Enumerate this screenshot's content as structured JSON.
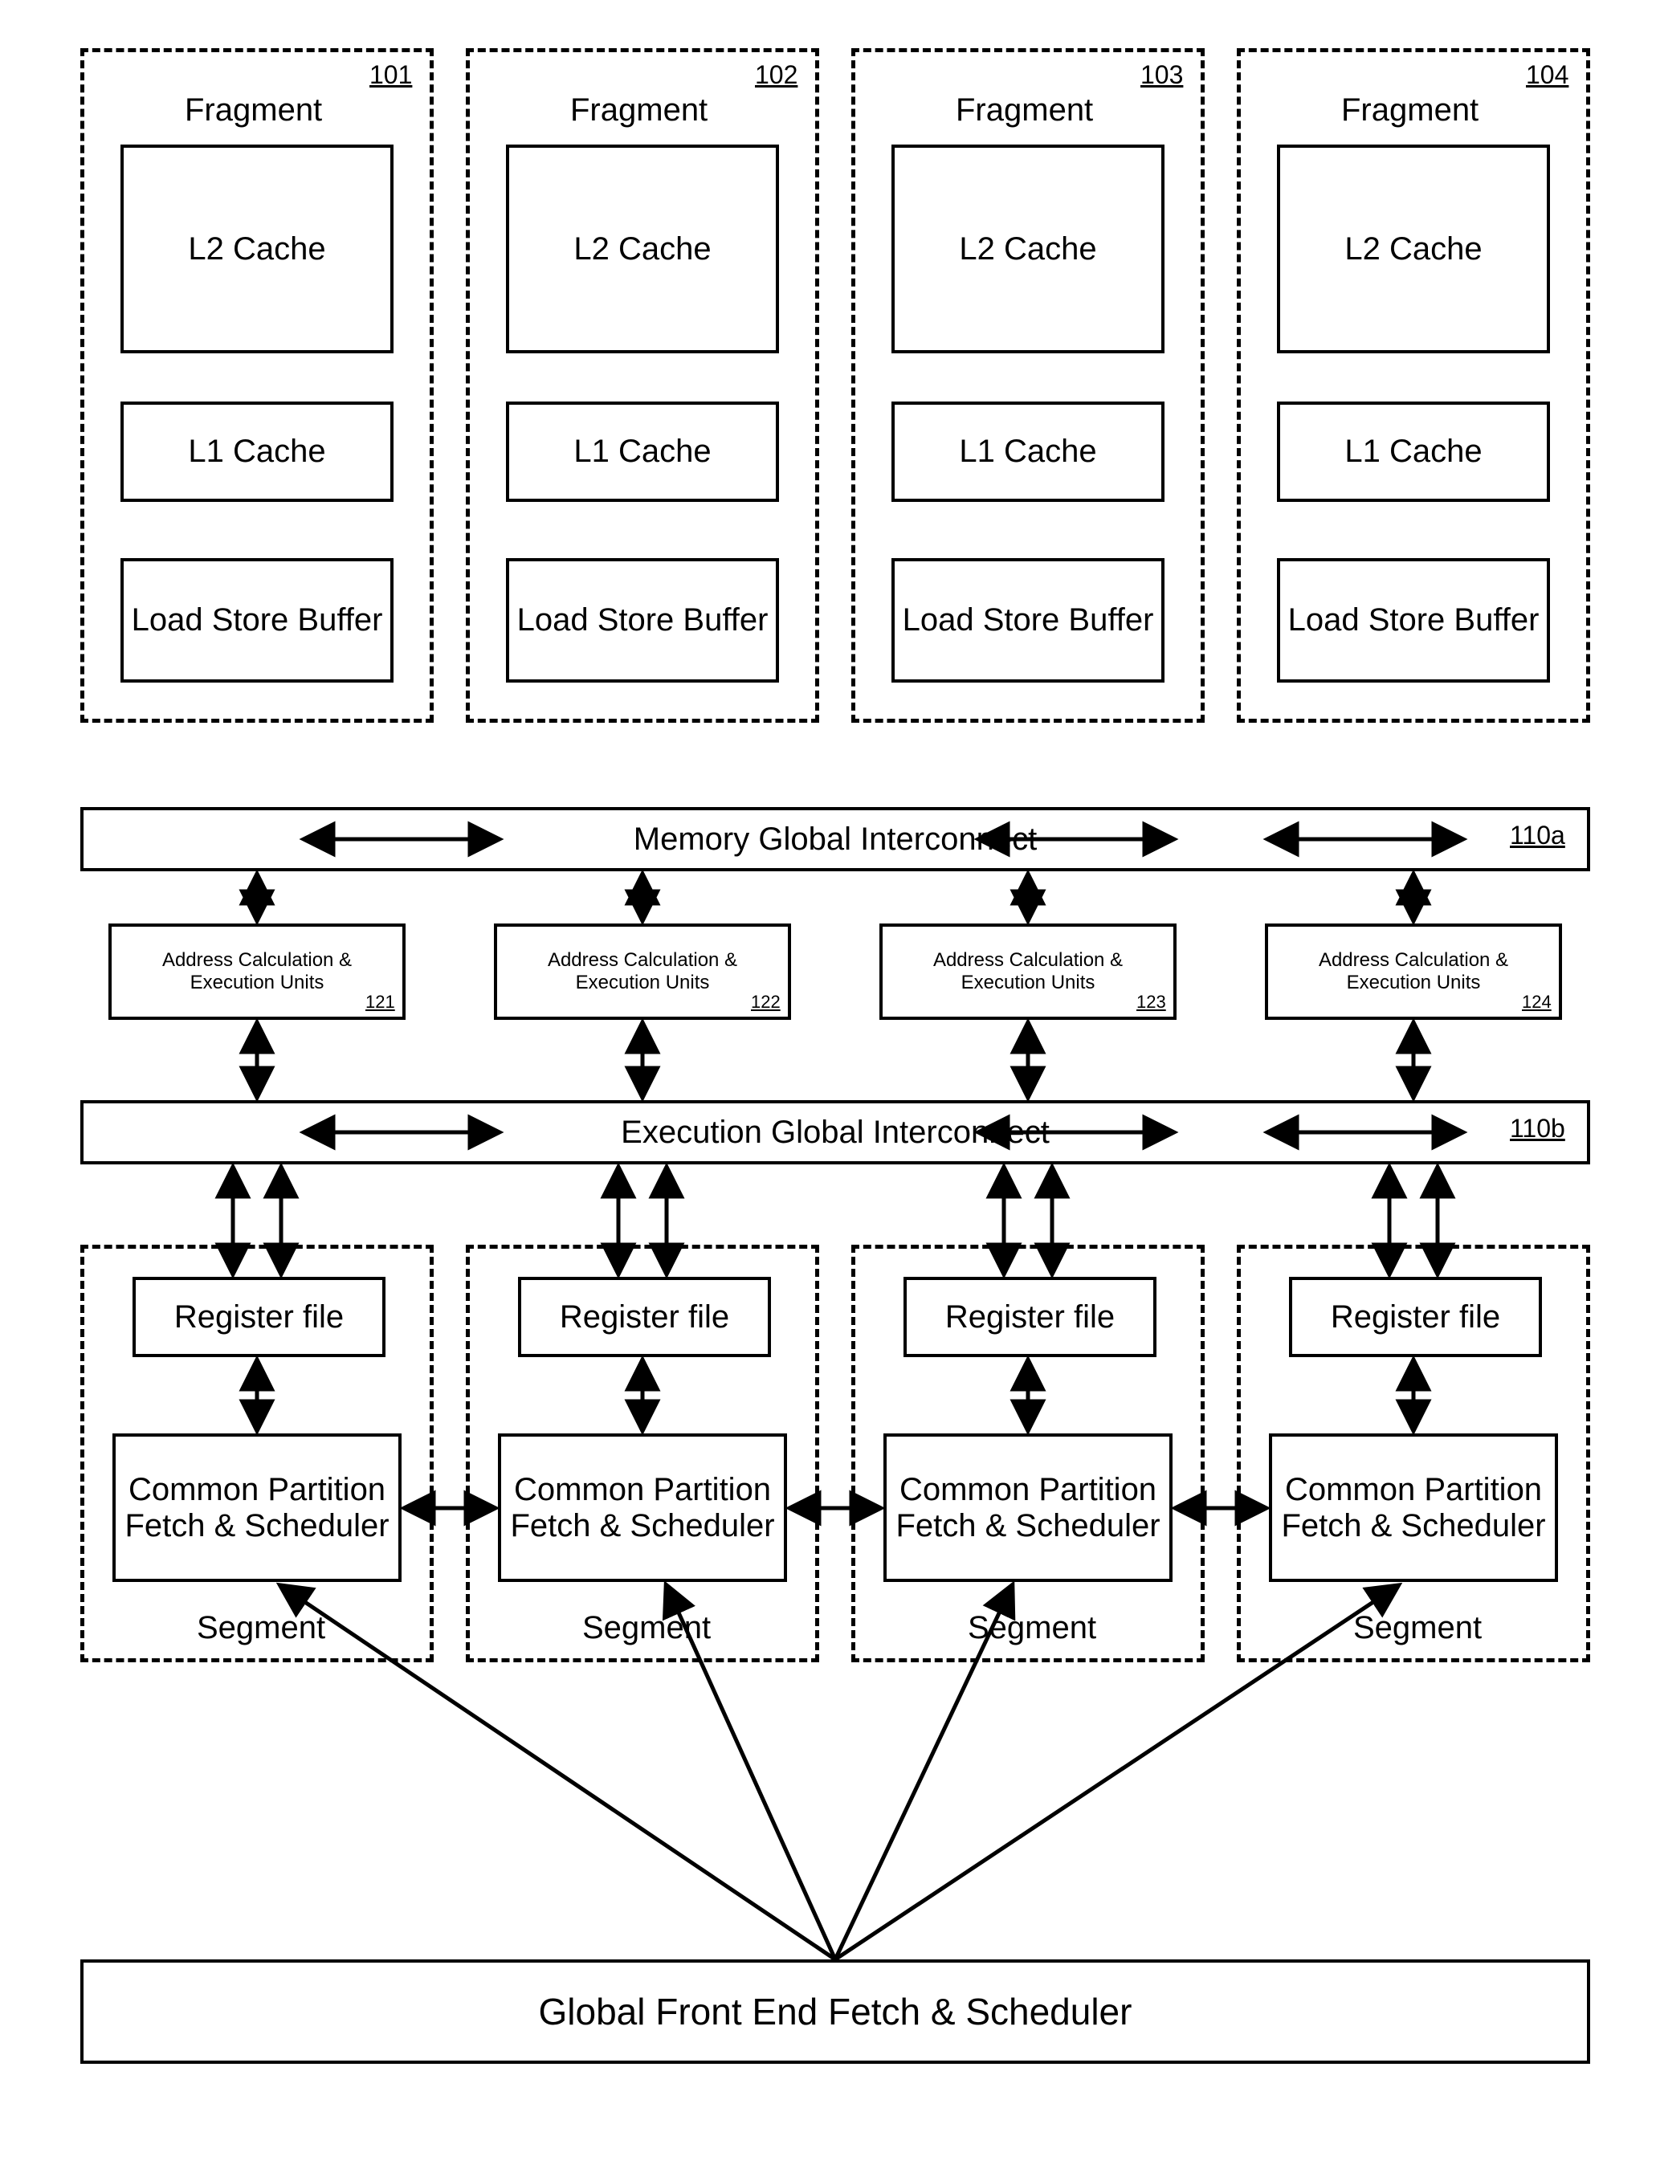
{
  "fragments": [
    {
      "ref": "101",
      "title": "Fragment",
      "l2": "L2 Cache",
      "l1": "L1 Cache",
      "lsb": "Load Store Buffer"
    },
    {
      "ref": "102",
      "title": "Fragment",
      "l2": "L2 Cache",
      "l1": "L1 Cache",
      "lsb": "Load Store Buffer"
    },
    {
      "ref": "103",
      "title": "Fragment",
      "l2": "L2 Cache",
      "l1": "L1 Cache",
      "lsb": "Load Store Buffer"
    },
    {
      "ref": "104",
      "title": "Fragment",
      "l2": "L2 Cache",
      "l1": "L1 Cache",
      "lsb": "Load Store Buffer"
    }
  ],
  "mem_interconnect": {
    "label": "Memory Global Interconnect",
    "ref": "110a"
  },
  "units": [
    {
      "label": "Address Calculation & Execution Units",
      "ref": "121"
    },
    {
      "label": "Address Calculation & Execution Units",
      "ref": "122"
    },
    {
      "label": "Address Calculation & Execution Units",
      "ref": "123"
    },
    {
      "label": "Address Calculation & Execution Units",
      "ref": "124"
    }
  ],
  "exec_interconnect": {
    "label": "Execution Global Interconnect",
    "ref": "110b"
  },
  "segments": [
    {
      "regfile": "Register file",
      "cps": "Common Partition Fetch & Scheduler",
      "label": "Segment"
    },
    {
      "regfile": "Register file",
      "cps": "Common Partition Fetch & Scheduler",
      "label": "Segment"
    },
    {
      "regfile": "Register file",
      "cps": "Common Partition Fetch & Scheduler",
      "label": "Segment"
    },
    {
      "regfile": "Register file",
      "cps": "Common Partition Fetch & Scheduler",
      "label": "Segment"
    }
  ],
  "global_fe": "Global Front End Fetch & Scheduler"
}
